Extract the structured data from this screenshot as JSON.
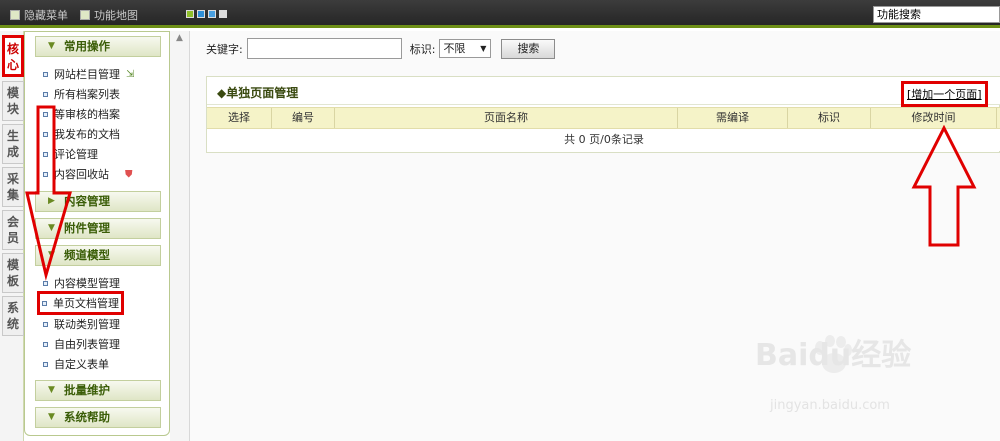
{
  "topbar": {
    "hide_menu": "隐藏菜单",
    "function_map": "功能地图",
    "function_search": "功能搜索",
    "swatches": [
      "#8fbf2b",
      "#2f8fd6",
      "#4aa0e0",
      "#dddddd"
    ]
  },
  "vtabs": [
    "核心",
    "模块",
    "生成",
    "采集",
    "会员",
    "模板",
    "系统"
  ],
  "sidebar": {
    "sections": {
      "common": "常用操作",
      "content": "内容管理",
      "attachments": "附件管理",
      "channel_models": "频道模型",
      "batch": "批量维护",
      "help": "系统帮助"
    },
    "common_items": [
      "网站栏目管理",
      "所有档案列表",
      "等审核的档案",
      "我发布的文档",
      "评论管理",
      "内容回收站"
    ],
    "channel_items": [
      "内容模型管理",
      "单页文档管理",
      "联动类别管理",
      "自由列表管理",
      "自定义表单"
    ]
  },
  "main": {
    "search": {
      "keyword_label": "关键字:",
      "tag_label": "标识:",
      "tag_value": "不限",
      "search_button": "搜索"
    },
    "panel": {
      "title": "◆单独页面管理",
      "add_link": "[增加一个页面]",
      "columns": [
        "选择",
        "编号",
        "页面名称",
        "需编译",
        "标识",
        "修改时间"
      ],
      "footer": "共 0 页/0条记录"
    }
  },
  "watermark": {
    "brand": "Baidu经验",
    "url": "jingyan.baidu.com"
  },
  "colors": {
    "accent_red": "#e00000",
    "nav_green": "#3a5d07"
  }
}
